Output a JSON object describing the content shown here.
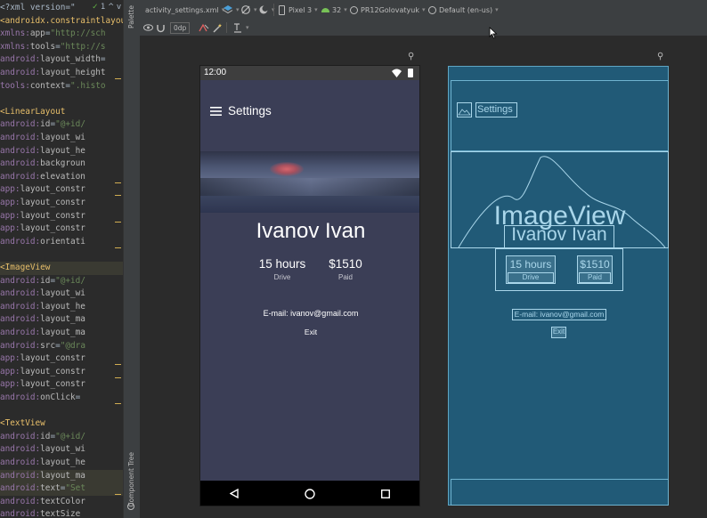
{
  "code_lines": [
    {
      "parts": [
        [
          "t-txt",
          "<?xml version=\""
        ]
      ]
    },
    {
      "parts": [
        [
          "t-tag",
          "<androidx.constraintlayout"
        ]
      ]
    },
    {
      "parts": [
        [
          "t-ns",
          "    xmlns:"
        ],
        [
          "t-attr",
          "app"
        ],
        [
          "t-txt",
          "="
        ],
        [
          "t-str",
          "\"http://sch"
        ]
      ]
    },
    {
      "parts": [
        [
          "t-ns",
          "    xmlns:"
        ],
        [
          "t-attr",
          "tools"
        ],
        [
          "t-txt",
          "="
        ],
        [
          "t-str",
          "\"http://s"
        ]
      ]
    },
    {
      "parts": [
        [
          "t-ns",
          "    android:"
        ],
        [
          "t-attr",
          "layout_width"
        ],
        [
          "t-txt",
          "="
        ]
      ]
    },
    {
      "parts": [
        [
          "t-ns",
          "    android:"
        ],
        [
          "t-attr",
          "layout_height"
        ]
      ]
    },
    {
      "parts": [
        [
          "t-ns",
          "    tools:"
        ],
        [
          "t-attr",
          "context"
        ],
        [
          "t-txt",
          "="
        ],
        [
          "t-str",
          "\".histo"
        ]
      ]
    },
    {
      "parts": []
    },
    {
      "parts": [
        [
          "t-tag",
          "    <LinearLayout"
        ]
      ]
    },
    {
      "parts": [
        [
          "t-ns",
          "        android:"
        ],
        [
          "t-attr",
          "id"
        ],
        [
          "t-txt",
          "="
        ],
        [
          "t-str",
          "\"@+id/"
        ]
      ]
    },
    {
      "parts": [
        [
          "t-ns",
          "        android:"
        ],
        [
          "t-attr",
          "layout_wi"
        ]
      ]
    },
    {
      "parts": [
        [
          "t-ns",
          "        android:"
        ],
        [
          "t-attr",
          "layout_he"
        ]
      ]
    },
    {
      "parts": [
        [
          "t-ns",
          "        android:"
        ],
        [
          "t-attr",
          "backgroun"
        ]
      ]
    },
    {
      "parts": [
        [
          "t-ns",
          "        android:"
        ],
        [
          "t-attr",
          "elevation"
        ]
      ]
    },
    {
      "parts": [
        [
          "t-ns",
          "        app:"
        ],
        [
          "t-attr",
          "layout_constr"
        ]
      ]
    },
    {
      "parts": [
        [
          "t-ns",
          "        app:"
        ],
        [
          "t-attr",
          "layout_constr"
        ]
      ]
    },
    {
      "parts": [
        [
          "t-ns",
          "        app:"
        ],
        [
          "t-attr",
          "layout_constr"
        ]
      ]
    },
    {
      "parts": [
        [
          "t-ns",
          "        app:"
        ],
        [
          "t-attr",
          "layout_constr"
        ]
      ]
    },
    {
      "parts": [
        [
          "t-ns",
          "        android:"
        ],
        [
          "t-attr",
          "orientati"
        ]
      ]
    },
    {
      "parts": []
    },
    {
      "parts": [
        [
          "t-tag",
          "    <ImageView"
        ]
      ],
      "hl": true
    },
    {
      "parts": [
        [
          "t-ns",
          "        android:"
        ],
        [
          "t-attr",
          "id"
        ],
        [
          "t-txt",
          "="
        ],
        [
          "t-str",
          "\"@+id/"
        ]
      ]
    },
    {
      "parts": [
        [
          "t-ns",
          "        android:"
        ],
        [
          "t-attr",
          "layout_wi"
        ]
      ]
    },
    {
      "parts": [
        [
          "t-ns",
          "        android:"
        ],
        [
          "t-attr",
          "layout_he"
        ]
      ]
    },
    {
      "parts": [
        [
          "t-ns",
          "        android:"
        ],
        [
          "t-attr",
          "layout_ma"
        ]
      ]
    },
    {
      "parts": [
        [
          "t-ns",
          "        android:"
        ],
        [
          "t-attr",
          "layout_ma"
        ]
      ]
    },
    {
      "parts": [
        [
          "t-ns",
          "        android:"
        ],
        [
          "t-attr",
          "src"
        ],
        [
          "t-txt",
          "="
        ],
        [
          "t-str",
          "\"@dra"
        ]
      ]
    },
    {
      "parts": [
        [
          "t-ns",
          "        app:"
        ],
        [
          "t-attr",
          "layout_constr"
        ]
      ]
    },
    {
      "parts": [
        [
          "t-ns",
          "        app:"
        ],
        [
          "t-attr",
          "layout_constr"
        ]
      ]
    },
    {
      "parts": [
        [
          "t-ns",
          "        app:"
        ],
        [
          "t-attr",
          "layout_constr"
        ]
      ]
    },
    {
      "parts": [
        [
          "t-ns",
          "        android:"
        ],
        [
          "t-attr",
          "onClick"
        ],
        [
          "t-txt",
          "="
        ]
      ]
    },
    {
      "parts": []
    },
    {
      "parts": [
        [
          "t-tag",
          "    <TextView"
        ]
      ]
    },
    {
      "parts": [
        [
          "t-ns",
          "        android:"
        ],
        [
          "t-attr",
          "id"
        ],
        [
          "t-txt",
          "="
        ],
        [
          "t-str",
          "\"@+id/"
        ]
      ]
    },
    {
      "parts": [
        [
          "t-ns",
          "        android:"
        ],
        [
          "t-attr",
          "layout_wi"
        ]
      ]
    },
    {
      "parts": [
        [
          "t-ns",
          "        android:"
        ],
        [
          "t-attr",
          "layout_he"
        ]
      ]
    },
    {
      "parts": [
        [
          "t-ns",
          "        android:"
        ],
        [
          "t-attr",
          "layout_ma"
        ]
      ],
      "hl": true
    },
    {
      "parts": [
        [
          "t-ns",
          "        android:"
        ],
        [
          "t-attr",
          "text"
        ],
        [
          "t-txt",
          "="
        ],
        [
          "t-str",
          "\"Set"
        ]
      ],
      "hl": true
    },
    {
      "parts": [
        [
          "t-ns",
          "        android:"
        ],
        [
          "t-attr",
          "textColor"
        ]
      ]
    },
    {
      "parts": [
        [
          "t-ns",
          "        android:"
        ],
        [
          "t-attr",
          "textSize"
        ]
      ]
    }
  ],
  "code_inspect": {
    "check": "✓",
    "count": "1",
    "up": "^",
    "down": "v"
  },
  "side_strip": {
    "palette": "Palette",
    "component_tree": "Component Tree"
  },
  "toolbar": {
    "file": "activity_settings.xml",
    "device": "Pixel 3",
    "api": "32",
    "theme": "PR12Golovatyuk",
    "locale": "Default (en-us)",
    "margin": "0dp"
  },
  "device": {
    "time": "12:00",
    "title": "Settings",
    "name": "Ivanov Ivan",
    "stats": [
      {
        "value": "15 hours",
        "label": "Drive"
      },
      {
        "value": "$1510",
        "label": "Paid"
      }
    ],
    "email": "E-mail: ivanov@gmail.com",
    "exit": "Exit"
  },
  "blueprint": {
    "title": "Settings",
    "image_label": "ImageView",
    "name": "Ivanov Ivan",
    "stats": [
      {
        "value": "15 hours",
        "label": "Drive"
      },
      {
        "value": "$1510",
        "label": "Paid"
      }
    ],
    "email": "E-mail: ivanov@gmail.com",
    "exit": "Exit"
  },
  "colors": {
    "blueprint_bg": "#215a77",
    "device_bg": "#3b3e56",
    "ide_bg": "#2b2b2b"
  }
}
